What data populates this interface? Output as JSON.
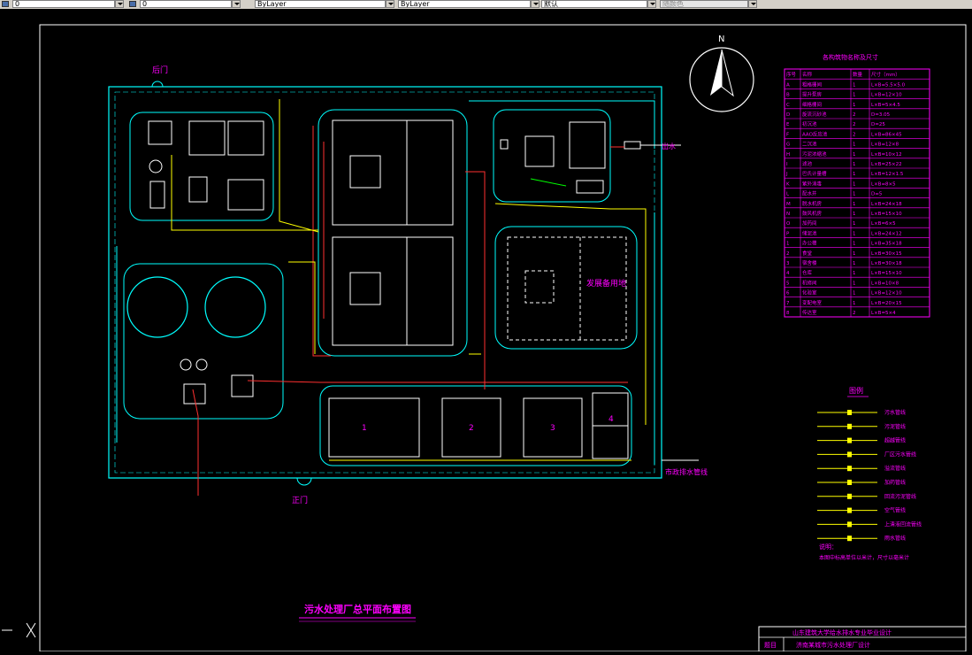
{
  "toolbar": {
    "layer_value": "0",
    "style_value": "0",
    "color_value": "ByLayer",
    "linetype_value": "ByLayer",
    "lineweight_value": "默认",
    "plotstyle_value": "随颜色"
  },
  "drawing": {
    "north_label": "N",
    "gate_top_label": "后门",
    "gate_bottom_label": "正门",
    "outlet_label": "出水",
    "sewer_label": "市政排水管线",
    "main_title": "污水处理厂总平面布置图",
    "future_land_label": "发展备用地",
    "pool_labels": [
      "1",
      "2",
      "3",
      "4"
    ],
    "notes_title": "说明：",
    "notes_text": "本图中标高单位以米计，尺寸以毫米计"
  },
  "structure_table": {
    "title": "各构筑物名称及尺寸",
    "headers": [
      "序号",
      "名称",
      "数量",
      "尺寸（mm）"
    ],
    "rows": [
      [
        "A",
        "粗格栅间",
        "1",
        "L×B=5.5×5.0"
      ],
      [
        "B",
        "提升泵房",
        "1",
        "L×B=12×10"
      ],
      [
        "C",
        "细格栅间",
        "1",
        "L×B=5×4.5"
      ],
      [
        "D",
        "旋流沉砂池",
        "2",
        "D=3.05"
      ],
      [
        "E",
        "初沉池",
        "2",
        "D=25"
      ],
      [
        "F",
        "AAO反应池",
        "2",
        "L×B=86×45"
      ],
      [
        "G",
        "二沉池",
        "1",
        "L×B=12×8"
      ],
      [
        "H",
        "污泥浓缩池",
        "1",
        "L×B=10×12"
      ],
      [
        "I",
        "滤池",
        "1",
        "L×B=25×22"
      ],
      [
        "J",
        "巴氏计量槽",
        "1",
        "L×B=12×1.5"
      ],
      [
        "K",
        "紫外消毒",
        "1",
        "L×B=8×5"
      ],
      [
        "L",
        "配水井",
        "1",
        "D=5"
      ],
      [
        "M",
        "脱水机房",
        "1",
        "L×B=24×18"
      ],
      [
        "N",
        "鼓风机房",
        "1",
        "L×B=15×10"
      ],
      [
        "O",
        "加药间",
        "1",
        "L×B=6×5"
      ],
      [
        "P",
        "储泥池",
        "1",
        "L×B=24×12"
      ],
      [
        "1",
        "办公楼",
        "1",
        "L×B=35×18"
      ],
      [
        "2",
        "食堂",
        "1",
        "L×B=30×15"
      ],
      [
        "3",
        "宿舍楼",
        "1",
        "L×B=30×18"
      ],
      [
        "4",
        "仓库",
        "1",
        "L×B=15×10"
      ],
      [
        "5",
        "机修间",
        "1",
        "L×B=10×8"
      ],
      [
        "6",
        "化验室",
        "1",
        "L×B=12×10"
      ],
      [
        "7",
        "变配电室",
        "1",
        "L×B=20×15"
      ],
      [
        "8",
        "传达室",
        "2",
        "L×B=5×4"
      ]
    ]
  },
  "legend": {
    "title": "图例",
    "items": [
      "污水管线",
      "污泥管线",
      "超越管线",
      "厂区污水管线",
      "溢流管线",
      "加药管线",
      "回流污泥管线",
      "空气管线",
      "上清液回流管线",
      "雨水管线"
    ]
  },
  "title_block": {
    "line1": "山东建筑大学给水排水专业毕业设计",
    "label": "题目",
    "line2": "济南某城市污水处理厂设计"
  },
  "colors": {
    "background": "#000000",
    "cyan": "#00ffff",
    "magenta": "#ff00ff",
    "yellow": "#ffff00",
    "red": "#ff3030",
    "green": "#00ff00",
    "white": "#ffffff"
  }
}
